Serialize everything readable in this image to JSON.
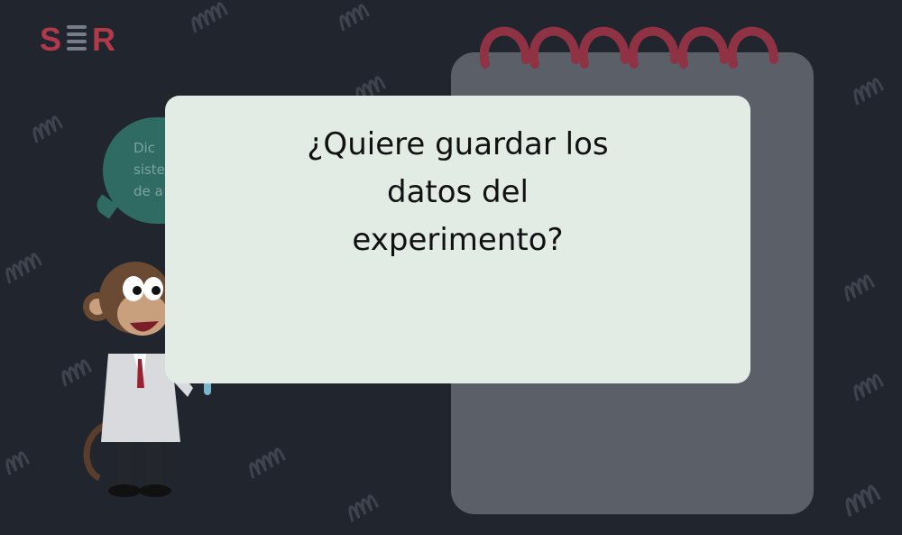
{
  "app": {
    "logo_text": "S R"
  },
  "background": {
    "speech_bubble_lines": [
      "Dic",
      "siste",
      "de a"
    ],
    "decor_icon": "spring-icon"
  },
  "modal": {
    "question_lines": [
      "¿Quiere guardar los",
      "datos del",
      "experimento?"
    ]
  },
  "colors": {
    "page_background": "#20252e",
    "modal_background": "#e3ece4",
    "notepad_background": "#5a5f68",
    "ring_color": "#8f3344",
    "bubble_background": "#2f6b62",
    "brand_red": "#b03a4a"
  }
}
